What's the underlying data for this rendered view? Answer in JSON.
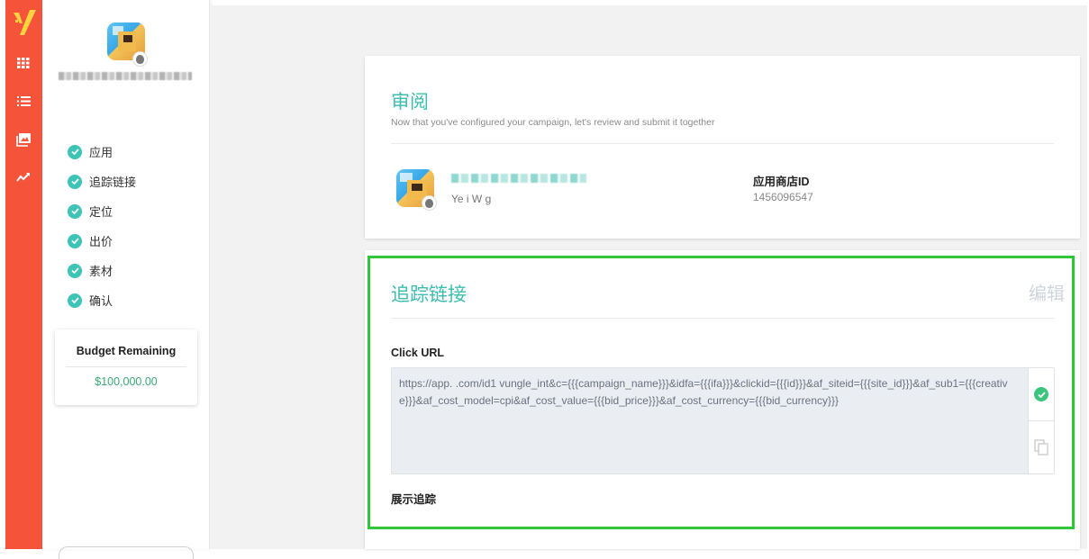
{
  "sidebar": {
    "steps": [
      {
        "label": "应用"
      },
      {
        "label": "追踪链接"
      },
      {
        "label": "定位"
      },
      {
        "label": "出价"
      },
      {
        "label": "素材"
      },
      {
        "label": "确认"
      }
    ],
    "budget": {
      "title": "Budget Remaining",
      "value": "$100,000.00"
    }
  },
  "review": {
    "title": "审阅",
    "subtitle": "Now that you've configured your campaign, let's review and submit it together",
    "developer": "Ye     i W    g",
    "store_label": "应用商店ID",
    "store_value": "1456096547"
  },
  "tracking": {
    "title": "追踪链接",
    "edit_label": "编辑",
    "click_label": "Click URL",
    "click_url": "https://app.         .com/id1               vungle_int&c={{{campaign_name}}}&idfa={{{ifa}}}&clickid={{{id}}}&af_siteid={{{site_id}}}&af_sub1={{{creative}}}&af_cost_model=cpi&af_cost_value={{{bid_price}}}&af_cost_currency={{{bid_currency}}}",
    "impression_label": "展示追踪"
  },
  "colors": {
    "brand_rail": "#f5543b",
    "accent_teal": "#3cbdb0",
    "success_green": "#3cc47e",
    "highlight_green": "#2fc737"
  },
  "icons": {
    "rail": [
      "vungle-logo-icon",
      "grid-icon",
      "list-icon",
      "image-icon",
      "chart-line-icon"
    ],
    "check": "check-circle-icon",
    "copy": "copy-icon",
    "platform": "apple-icon"
  }
}
